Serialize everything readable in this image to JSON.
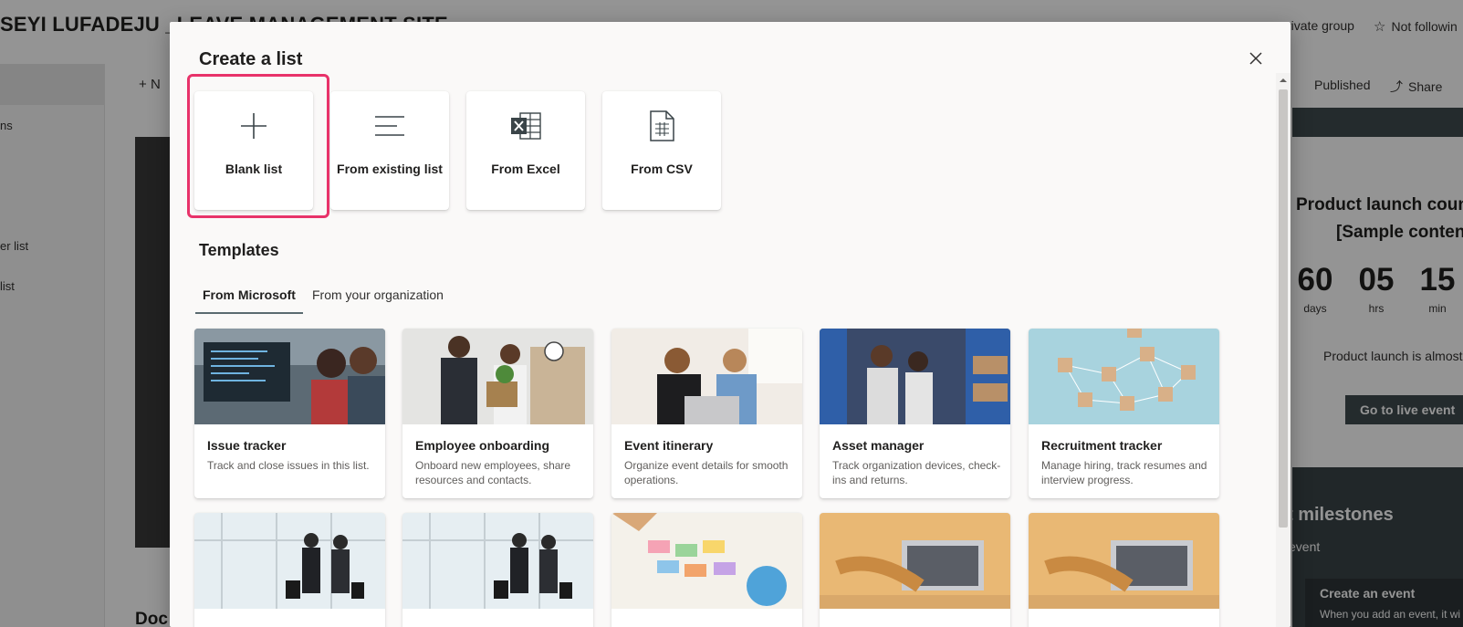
{
  "background": {
    "site_title": "SEYI LUFADEJU _LEAVE MANAGEMENT SITE",
    "group_label": "rivate group",
    "follow_label": "Not followin",
    "nav_items": [
      "ns",
      "er list",
      " list"
    ],
    "new_label": "N",
    "published_label": "Published",
    "share_label": "Share",
    "documents_label": "Doc",
    "right_panel": {
      "title_line1": "Product launch coun",
      "title_line2": "[Sample conten",
      "countdown": [
        {
          "num": "60",
          "unit": "days"
        },
        {
          "num": "05",
          "unit": "hrs"
        },
        {
          "num": "15",
          "unit": "min"
        }
      ],
      "message": "Product launch is almost",
      "live_button": "Go to live event",
      "milestones": "t milestones",
      "event_text": "event",
      "create_event_title": "Create an event",
      "create_event_desc": "When you add an event, it wi"
    }
  },
  "dialog": {
    "title": "Create a list",
    "options": [
      {
        "label": "Blank list",
        "icon": "plus-icon"
      },
      {
        "label": "From existing list",
        "icon": "lines-icon"
      },
      {
        "label": "From Excel",
        "icon": "excel-icon"
      },
      {
        "label": "From CSV",
        "icon": "csv-icon"
      }
    ],
    "highlighted_option": "Blank list",
    "templates_heading": "Templates",
    "tabs": [
      {
        "label": "From Microsoft",
        "active": true
      },
      {
        "label": "From your organization",
        "active": false
      }
    ],
    "templates_row1": [
      {
        "name": "Issue tracker",
        "desc": "Track and close issues in this list."
      },
      {
        "name": "Employee onboarding",
        "desc": "Onboard new employees, share resources and contacts."
      },
      {
        "name": "Event itinerary",
        "desc": "Organize event details for smooth operations."
      },
      {
        "name": "Asset manager",
        "desc": "Track organization devices, check-ins and returns."
      },
      {
        "name": "Recruitment tracker",
        "desc": "Manage hiring, track resumes and interview progress."
      }
    ]
  },
  "colors": {
    "highlight": "#e8336a",
    "accent": "#3f4a4e"
  }
}
